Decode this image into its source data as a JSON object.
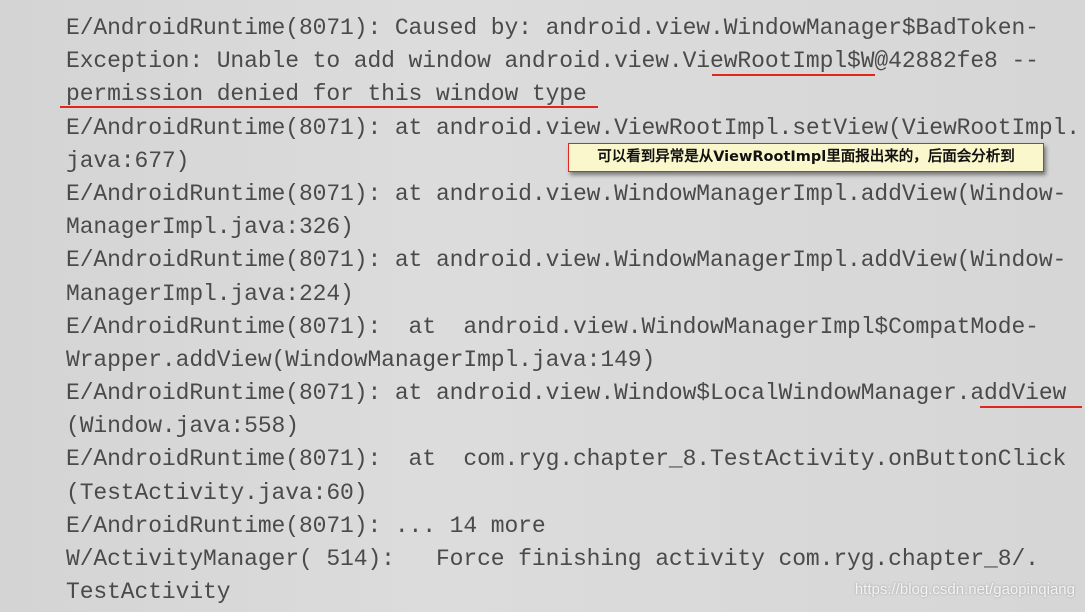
{
  "lines": [
    "E/AndroidRuntime(8071): Caused by: android.view.WindowManager$BadToken-",
    "Exception: Unable to add window android.view.ViewRootImpl$W@42882fe8 --",
    "permission denied for this window type",
    "E/AndroidRuntime(8071): at android.view.ViewRootImpl.setView(ViewRootImpl.",
    "java:677)",
    "E/AndroidRuntime(8071): at android.view.WindowManagerImpl.addView(Window-",
    "ManagerImpl.java:326)",
    "E/AndroidRuntime(8071): at android.view.WindowManagerImpl.addView(Window-",
    "ManagerImpl.java:224)",
    "E/AndroidRuntime(8071):  at  android.view.WindowManagerImpl$CompatMode-",
    "Wrapper.addView(WindowManagerImpl.java:149)",
    "E/AndroidRuntime(8071): at android.view.Window$LocalWindowManager.addView",
    "(Window.java:558)",
    "E/AndroidRuntime(8071):  at  com.ryg.chapter_8.TestActivity.onButtonClick",
    "(TestActivity.java:60)",
    "E/AndroidRuntime(8071): ... 14 more",
    "W/ActivityManager( 514):   Force finishing activity com.ryg.chapter_8/.",
    "TestActivity"
  ],
  "callout": "可以看到异常是从ViewRootImpl里面报出来的，后面会分析到",
  "watermark": "https://blog.csdn.net/gaopinqiang",
  "colors": {
    "highlight": "#e0261f",
    "callout_bg": "#fbf7cc",
    "text": "#4a4a4a"
  }
}
